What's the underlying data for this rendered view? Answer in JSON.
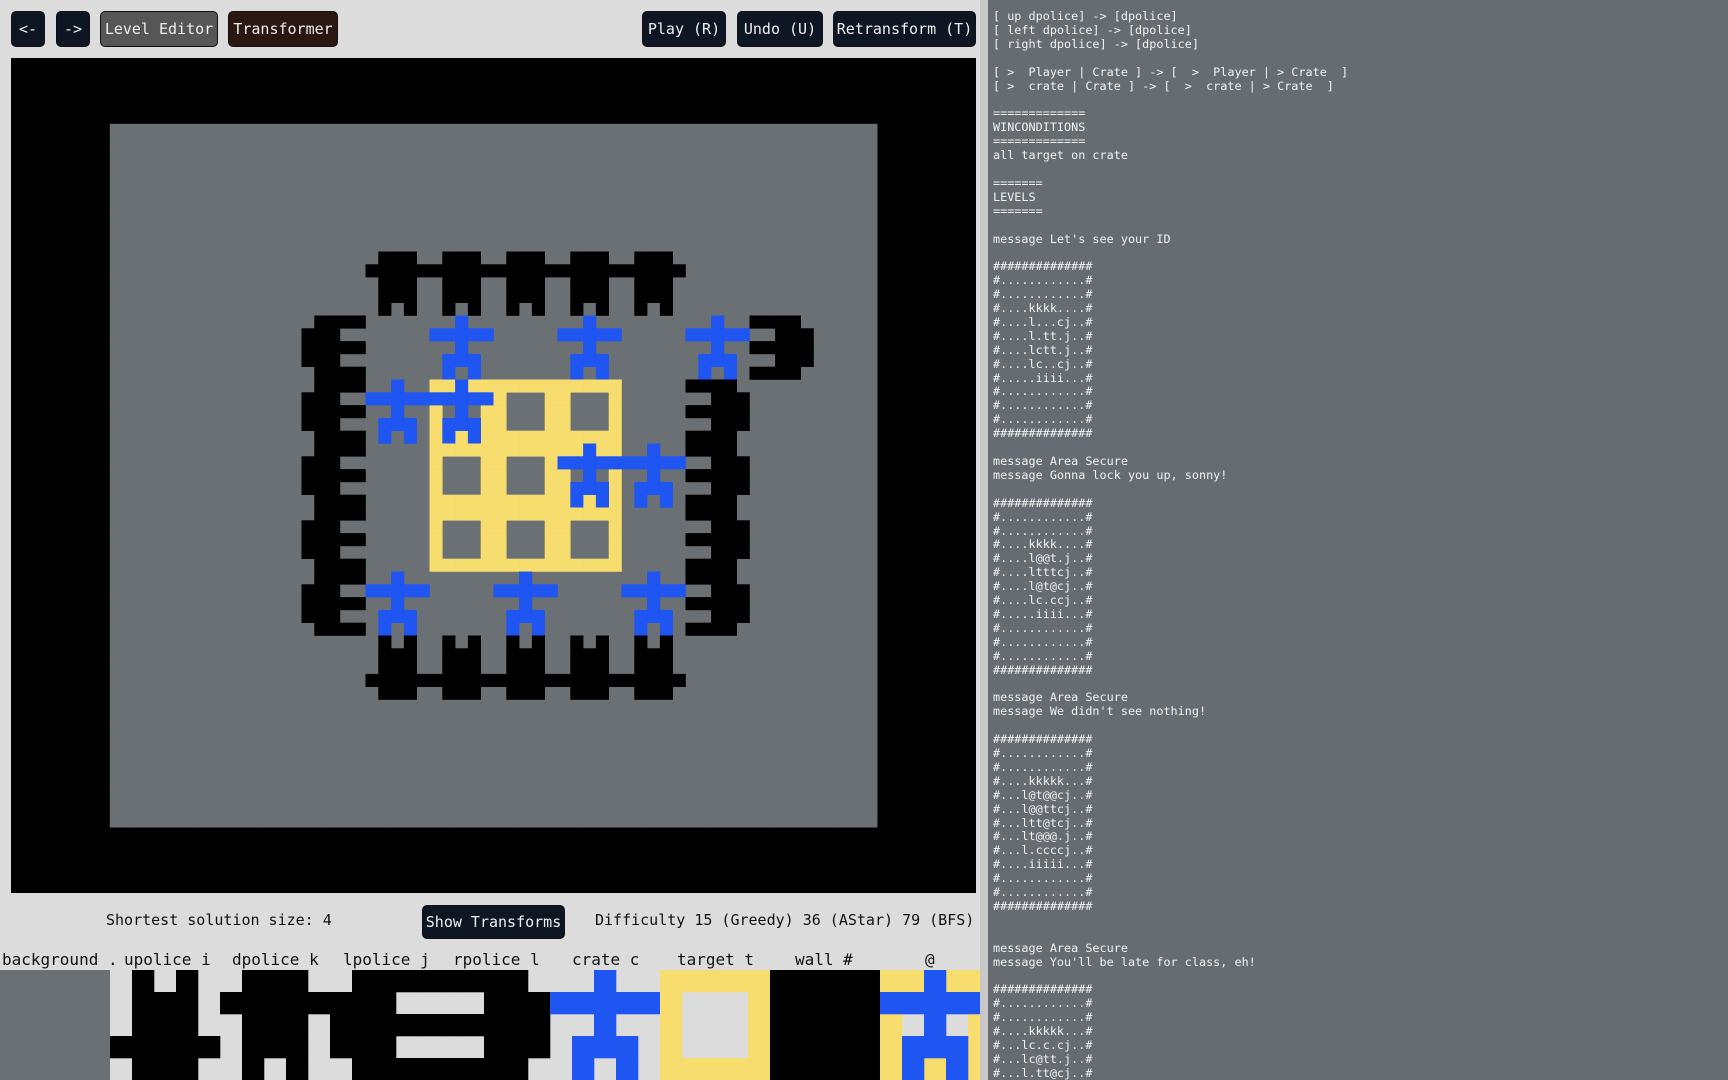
{
  "toolbar": {
    "back_label": "<-",
    "forward_label": "->",
    "level_editor_label": "Level Editor",
    "transformer_label": "Transformer",
    "play_label": "Play (R)",
    "undo_label": "Undo (U)",
    "retransform_label": "Retransform (T)"
  },
  "status": {
    "solution": "Shortest solution size: 4",
    "show_transforms_label": "Show Transforms",
    "difficulty": "Difficulty 15 (Greedy) 36 (AStar) 79 (BFS)"
  },
  "legend": [
    {
      "label": "background ."
    },
    {
      "label": "upolice i"
    },
    {
      "label": "dpolice k"
    },
    {
      "label": "lpolice j"
    },
    {
      "label": "rpolice l"
    },
    {
      "label": "crate c"
    },
    {
      "label": "target t"
    },
    {
      "label": "wall #"
    },
    {
      "label": "@"
    }
  ],
  "colors": {
    "background": "#6a7074",
    "police": "#000000",
    "crate": "#1f55f0",
    "target": "#f7dd6e",
    "wall": "#000000",
    "page": "#dcdcdc",
    "panel": "#676c72"
  },
  "level_rows": [
    "##############",
    "#............#",
    "#............#",
    "#....kkkkk...#",
    "#...l.c.c.cj.#",
    "#...lc@tt.j..#",
    "#...l.tt@cj..#",
    "#...l.ttt.j..#",
    "#...lc.c.cj..#",
    "#....iiiii...#",
    "#............#",
    "#............#",
    "##############"
  ],
  "source_text": "[ up dpolice] -> [dpolice]\n[ left dpolice] -> [dpolice]\n[ right dpolice] -> [dpolice]\n\n[ >  Player | Crate ] -> [  >  Player | > Crate  ]\n[ >  crate | Crate ] -> [  >  crate | > Crate  ]\n\n=============\nWINCONDITIONS\n=============\nall target on crate\n\n=======\nLEVELS\n=======\n\nmessage Let's see your ID\n\n##############\n#............#\n#............#\n#....kkkk....#\n#....l...cj..#\n#....l.tt.j..#\n#....lctt.j..#\n#....lc..cj..#\n#.....iiii...#\n#............#\n#............#\n#............#\n##############\n\nmessage Area Secure\nmessage Gonna lock you up, sonny!\n\n##############\n#............#\n#............#\n#....kkkk....#\n#....l@@t.j..#\n#....ltttcj..#\n#....l@t@cj..#\n#....lc.ccj..#\n#.....iiii...#\n#............#\n#............#\n#............#\n##############\n\nmessage Area Secure\nmessage We didn't see nothing!\n\n##############\n#............#\n#............#\n#....kkkkk...#\n#...l@t@@cj..#\n#...l@@ttcj..#\n#...ltt@tcj..#\n#...lt@@@.j..#\n#...l.ccccj..#\n#....iiiii...#\n#............#\n#............#\n##############\n\n\nmessage Area Secure\nmessage You'll be late for class, eh!\n\n##############\n#............#\n#............#\n#....kkkkk...#\n#...lc.c.cj..#\n#...lc@tt.j..#\n#...l.tt@cj..#\n#...l.ttt.j.."
}
